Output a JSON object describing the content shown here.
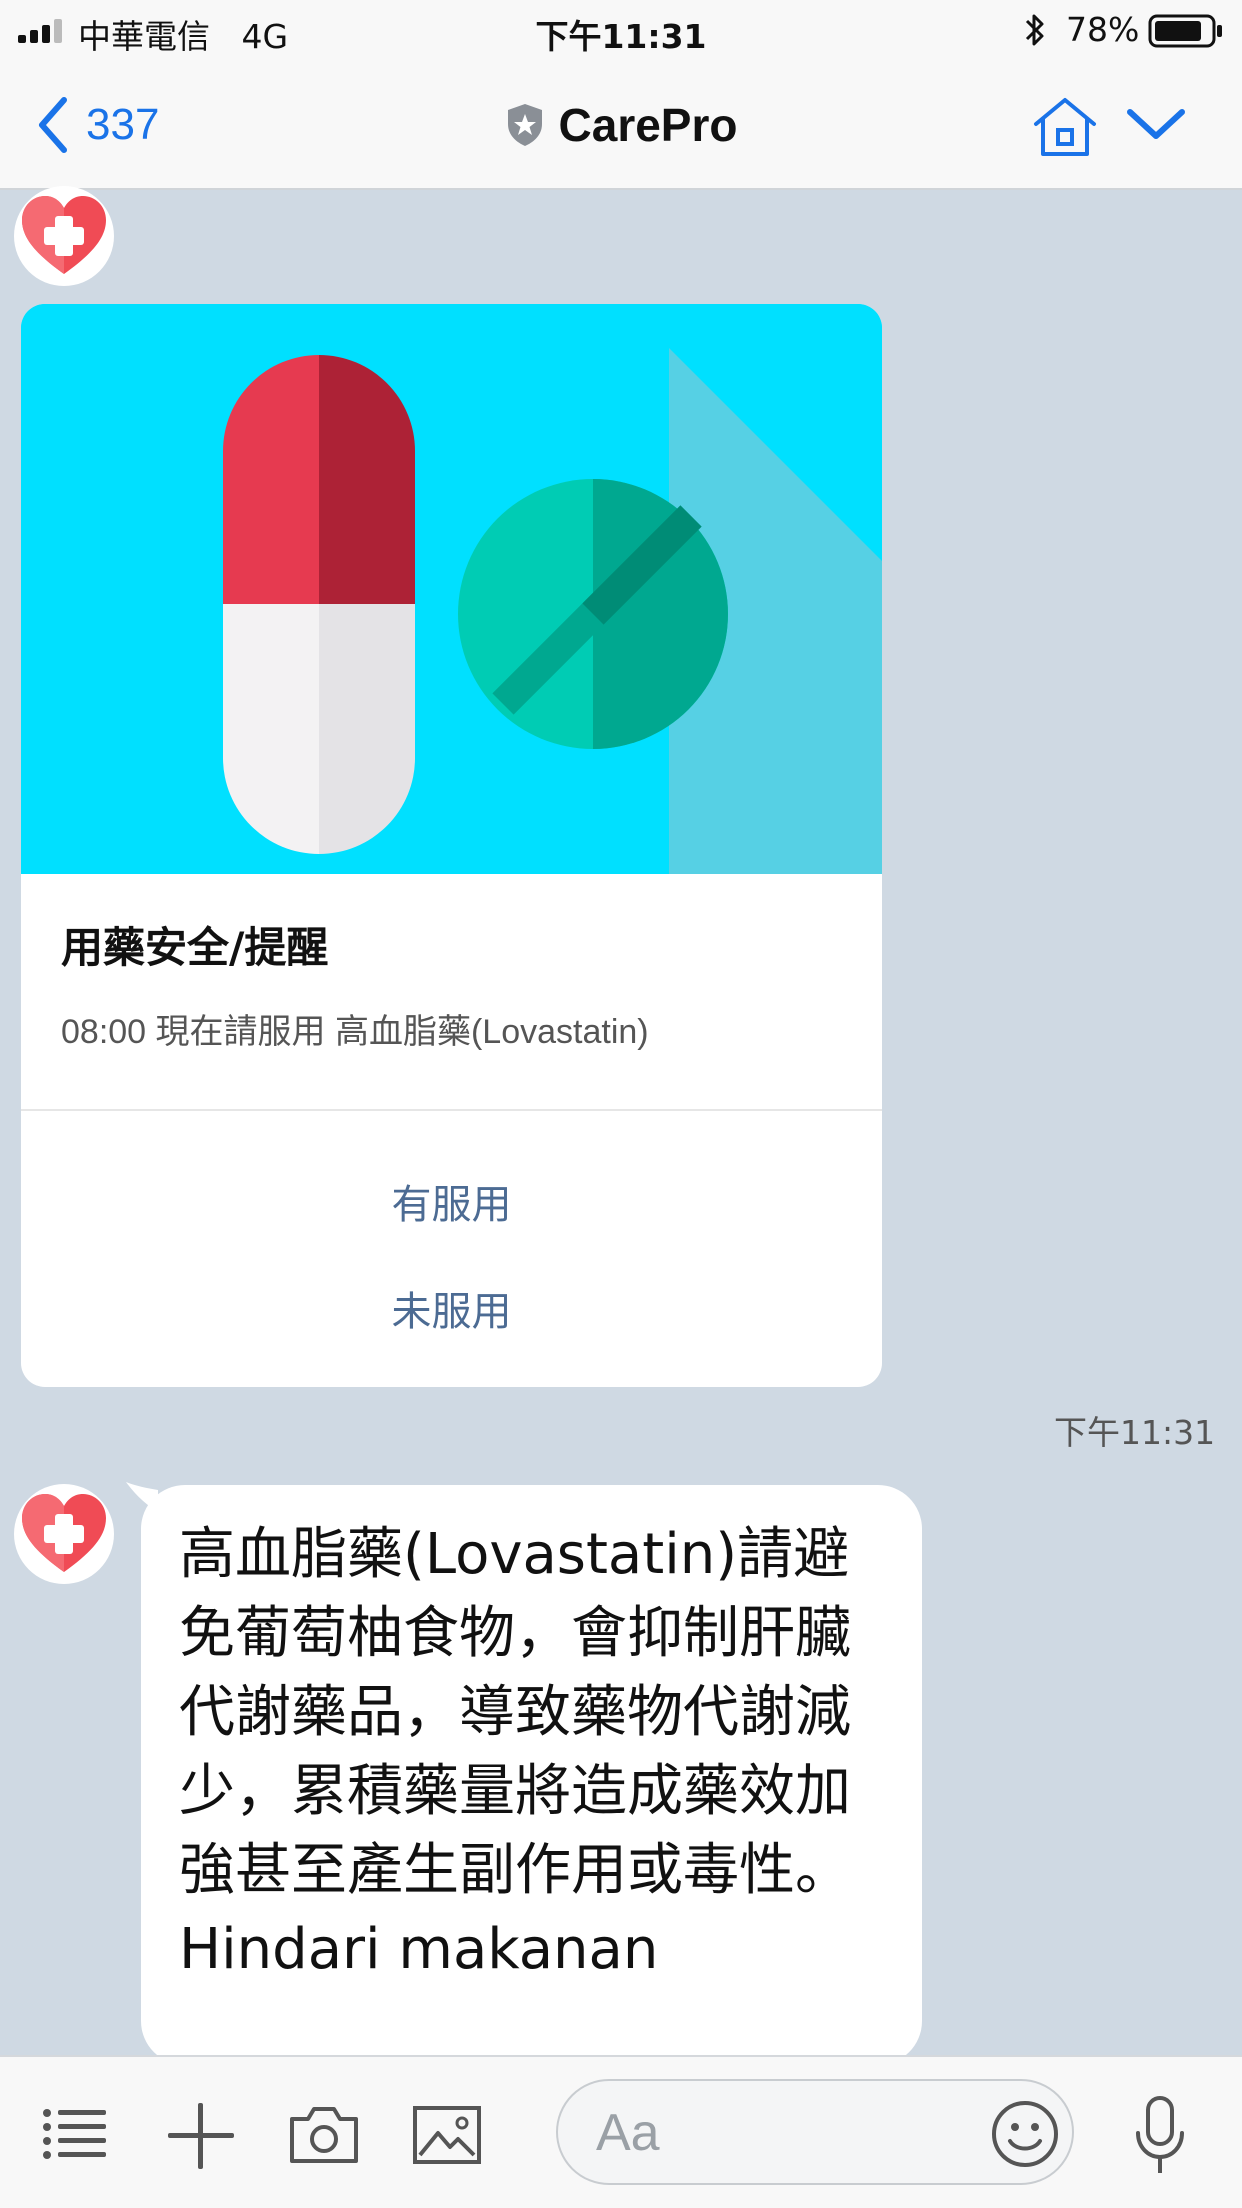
{
  "status_bar": {
    "carrier": "中華電信",
    "network": "4G",
    "time": "下午11:31",
    "battery_percent": "78%"
  },
  "nav": {
    "back_count": "337",
    "title": "CarePro",
    "accent_color": "#1a73e8"
  },
  "card": {
    "title": "用藥安全/提醒",
    "text": "08:00 現在請服用 高血脂藥(Lovastatin)",
    "actions": [
      "有服用",
      "未服用"
    ],
    "hero_color": "#00e0ff"
  },
  "message_time": "下午11:31",
  "bubble": {
    "text": "高血脂藥(Lovastatin)請避免葡萄柚食物，會抑制肝臟代謝藥品，導致藥物代謝減少，累積藥量將造成藥效加強甚至產生副作用或毒性。 Hindari makanan"
  },
  "input": {
    "placeholder": "Aa"
  },
  "icons": {
    "menu": "list-menu-icon",
    "add": "plus-icon",
    "camera": "camera-icon",
    "image": "image-icon",
    "emoji": "emoji-icon",
    "mic": "microphone-icon"
  }
}
